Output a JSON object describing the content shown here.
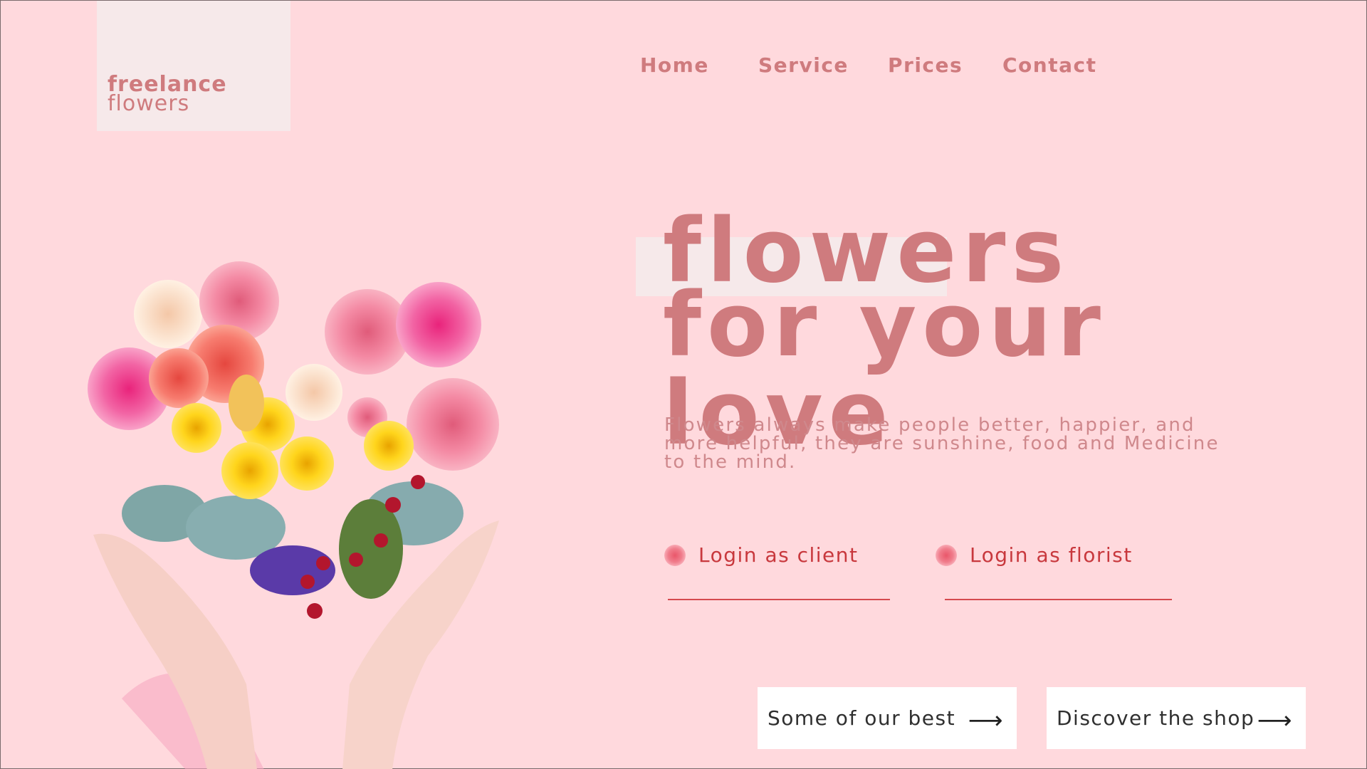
{
  "logo": {
    "line1": "freelance",
    "line2": "flowers"
  },
  "nav": {
    "items": [
      "Home",
      "Service",
      "Prices",
      "Contact"
    ]
  },
  "hero": {
    "title_line1": "flowers",
    "title_line2": "for your love",
    "description_lines": [
      "Flowers always make people better, happier, and",
      "more helpful, they are sunshine, food and Medicine",
      "to the mind."
    ]
  },
  "logins": [
    {
      "label": "Login as client",
      "icon": "flower-bullet-icon"
    },
    {
      "label": "Login as florist",
      "icon": "flower-bullet-icon"
    }
  ],
  "buttons": [
    {
      "label": "Some of our best",
      "arrow": "⟶"
    },
    {
      "label": "Discover the shop",
      "arrow": "⟶"
    }
  ],
  "colors": {
    "background": "#ffd9dd",
    "accent": "#cf7b7e",
    "link": "#c8383d",
    "panel": "#f6e9ea"
  }
}
